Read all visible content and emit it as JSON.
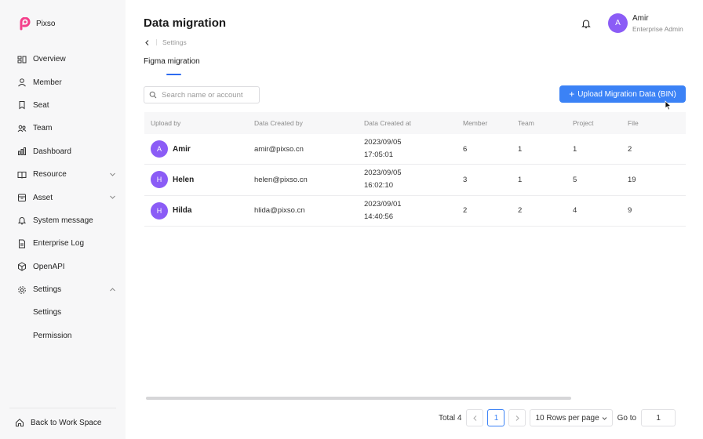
{
  "brand": {
    "name": "Pixso"
  },
  "sidebar": {
    "items": [
      {
        "label": "Overview",
        "icon": "overview-icon"
      },
      {
        "label": "Member",
        "icon": "member-icon"
      },
      {
        "label": "Seat",
        "icon": "seat-icon"
      },
      {
        "label": "Team",
        "icon": "team-icon"
      },
      {
        "label": "Dashboard",
        "icon": "dashboard-icon"
      },
      {
        "label": "Resource",
        "icon": "resource-icon",
        "expand": "chevron-down-icon"
      },
      {
        "label": "Asset",
        "icon": "asset-icon",
        "expand": "chevron-down-icon"
      },
      {
        "label": "System message",
        "icon": "bell-icon"
      },
      {
        "label": "Enterprise Log",
        "icon": "log-icon"
      },
      {
        "label": "OpenAPI",
        "icon": "cube-icon"
      },
      {
        "label": "Settings",
        "icon": "gear-icon",
        "expand": "chevron-up-icon"
      },
      {
        "label": "Settings",
        "sub": true
      },
      {
        "label": "Permission",
        "sub": true
      }
    ],
    "back_label": "Back to Work Space"
  },
  "header": {
    "title": "Data migration",
    "breadcrumb": "Settings",
    "user": {
      "initial": "A",
      "name": "Amir",
      "role": "Enterprise Admin"
    }
  },
  "tabs": {
    "active": "Figma migration"
  },
  "search": {
    "placeholder": "Search name or account",
    "value": ""
  },
  "upload_button": {
    "plus": "+",
    "label": "Upload Migration Data (BIN)"
  },
  "table": {
    "columns": [
      "Upload by",
      "Data Created by",
      "Data Created at",
      "Member",
      "Team",
      "Project",
      "File"
    ],
    "rows": [
      {
        "initial": "A",
        "name": "Amir",
        "email": "amir@pixso.cn",
        "date": "2023/09/05",
        "time": "17:05:01",
        "member": "6",
        "team": "1",
        "project": "1",
        "file": "2"
      },
      {
        "initial": "H",
        "name": "Helen",
        "email": "helen@pixso.cn",
        "date": "2023/09/05",
        "time": "16:02:10",
        "member": "3",
        "team": "1",
        "project": "5",
        "file": "19"
      },
      {
        "initial": "H",
        "name": "Hilda",
        "email": "hlida@pixso.cn",
        "date": "2023/09/01",
        "time": "14:40:56",
        "member": "2",
        "team": "2",
        "project": "4",
        "file": "9"
      }
    ]
  },
  "pagination": {
    "total": "Total 4",
    "current_page": "1",
    "rows_per_page": "10 Rows per page",
    "goto_label": "Go to",
    "goto_value": "1"
  },
  "colors": {
    "accent": "#3b82f6",
    "avatar": "#8b5cf6",
    "sidebar_bg": "#f7f7f8"
  }
}
